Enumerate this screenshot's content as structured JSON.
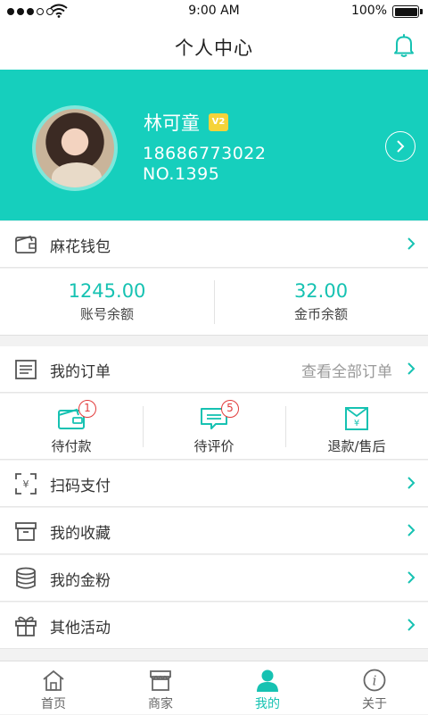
{
  "status_bar": {
    "time": "9:00 AM",
    "battery": "100%"
  },
  "header": {
    "title": "个人中心",
    "bell_icon": "bell-icon"
  },
  "profile": {
    "name": "林可童",
    "vip_badge": "V2",
    "phone": "18686773022",
    "member_no": "NO.1395",
    "accent_color": "#16cfbd"
  },
  "wallet": {
    "label": "麻花钱包",
    "account_balance": "1245.00",
    "account_balance_label": "账号余额",
    "coin_balance": "32.00",
    "coin_balance_label": "金币余额"
  },
  "orders": {
    "label": "我的订单",
    "view_all": "查看全部订单",
    "statuses": [
      {
        "label": "待付款",
        "badge": "1",
        "icon": "wallet-icon"
      },
      {
        "label": "待评价",
        "badge": "5",
        "icon": "comment-icon"
      },
      {
        "label": "退款/售后",
        "badge": "",
        "icon": "refund-icon"
      }
    ]
  },
  "menu": [
    {
      "label": "扫码支付",
      "icon": "scan-pay-icon"
    },
    {
      "label": "我的收藏",
      "icon": "favorites-box-icon"
    },
    {
      "label": "我的金粉",
      "icon": "coins-stack-icon"
    },
    {
      "label": "其他活动",
      "icon": "gift-icon"
    }
  ],
  "tabs": [
    {
      "label": "首页",
      "icon": "home-icon",
      "active": false
    },
    {
      "label": "商家",
      "icon": "store-icon",
      "active": false
    },
    {
      "label": "我的",
      "icon": "person-icon",
      "active": true
    },
    {
      "label": "关于",
      "icon": "info-icon",
      "active": false
    }
  ]
}
